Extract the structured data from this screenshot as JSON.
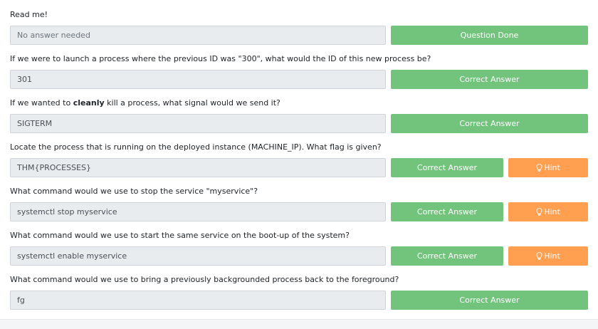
{
  "tasks": [
    {
      "question": "Read me!",
      "answer": "No answer needed",
      "answer_is_placeholder": true,
      "button_label": "Question Done",
      "has_hint": false
    },
    {
      "question": "If we were to launch a process where the previous ID was \"300\", what would the ID of this new process be?",
      "answer": "301",
      "button_label": "Correct Answer",
      "has_hint": false
    },
    {
      "question_before": "If we wanted to ",
      "question_bold": "cleanly",
      "question_after": " kill a process, what signal would we send it?",
      "answer": "SIGTERM",
      "button_label": "Correct Answer",
      "has_hint": false
    },
    {
      "question": "Locate the process that is running on the deployed instance (MACHINE_IP). What flag is given?",
      "answer": "THM{PROCESSES}",
      "button_label": "Correct Answer",
      "has_hint": true,
      "hint_label": "Hint"
    },
    {
      "question": "What command would we use to stop the service \"myservice\"?",
      "answer": "systemctl stop myservice",
      "button_label": "Correct Answer",
      "has_hint": true,
      "hint_label": "Hint"
    },
    {
      "question": "What command would we use to start the same service on the boot-up of the system?",
      "answer": "systemctl enable myservice",
      "button_label": "Correct Answer",
      "has_hint": true,
      "hint_label": "Hint"
    },
    {
      "question": "What command would we use to bring a previously backgrounded process back to the foreground?",
      "answer": "fg",
      "button_label": "Correct Answer",
      "has_hint": false
    }
  ],
  "colors": {
    "success": "#72c47c",
    "hint": "#ff9f4f",
    "answer_bg": "#e9ecef"
  },
  "icons": {
    "hint": "lightbulb-icon"
  }
}
